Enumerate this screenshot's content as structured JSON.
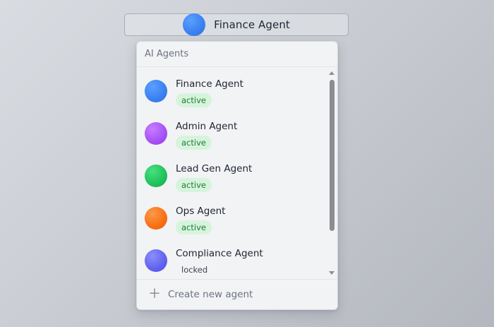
{
  "selector": {
    "label": "Finance Agent",
    "avatar_color": "#3d82f2"
  },
  "panel": {
    "header": "AI Agents",
    "footer": {
      "label": "Create new agent",
      "icon": "plus-icon"
    }
  },
  "agents": [
    {
      "name": "Finance Agent",
      "status": "active",
      "color": "#3d82f2"
    },
    {
      "name": "Admin Agent",
      "status": "active",
      "color": "#a855f7"
    },
    {
      "name": "Lead Gen Agent",
      "status": "active",
      "color": "#22c55e"
    },
    {
      "name": "Ops Agent",
      "status": "active",
      "color": "#f97316"
    },
    {
      "name": "Compliance Agent",
      "status": "locked",
      "color": "#6366f1"
    }
  ]
}
